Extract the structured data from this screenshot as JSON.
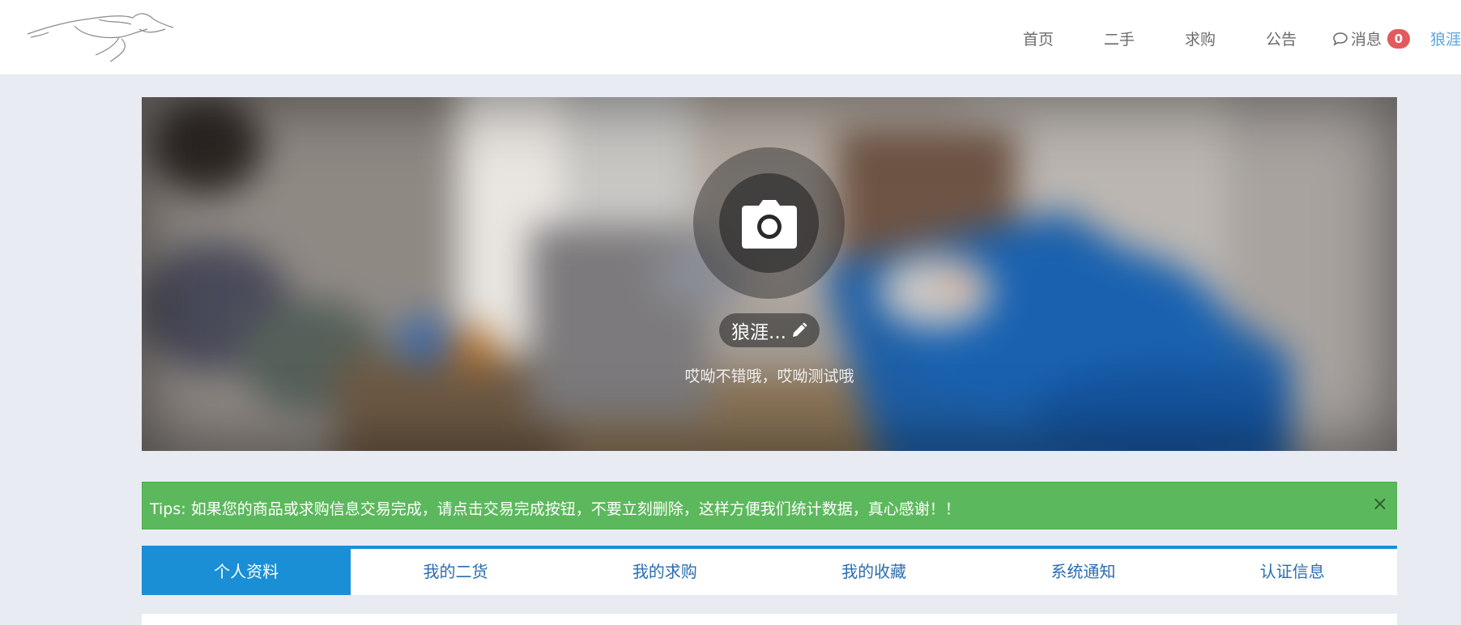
{
  "nav": {
    "home": "首页",
    "second_hand": "二手",
    "wanted": "求购",
    "notice": "公告",
    "messages": "消息",
    "message_count": "0",
    "user": "狼涯..."
  },
  "profile": {
    "name": "狼涯...",
    "signature": "哎呦不错哦，哎呦测试哦",
    "camera_icon": "camera-icon",
    "edit_icon": "pencil-icon"
  },
  "tips": {
    "text": "Tips: 如果您的商品或求购信息交易完成，请点击交易完成按钮，不要立刻删除，这样方便我们统计数据，真心感谢！！",
    "close": "×"
  },
  "tabs": [
    "个人资料",
    "我的二货",
    "我的求购",
    "我的收藏",
    "系统通知",
    "认证信息"
  ],
  "colors": {
    "accent": "#1a8fd6",
    "tips_bg": "#5cb85c",
    "badge": "#e25a5e",
    "page_bg": "#e8ebf2"
  }
}
